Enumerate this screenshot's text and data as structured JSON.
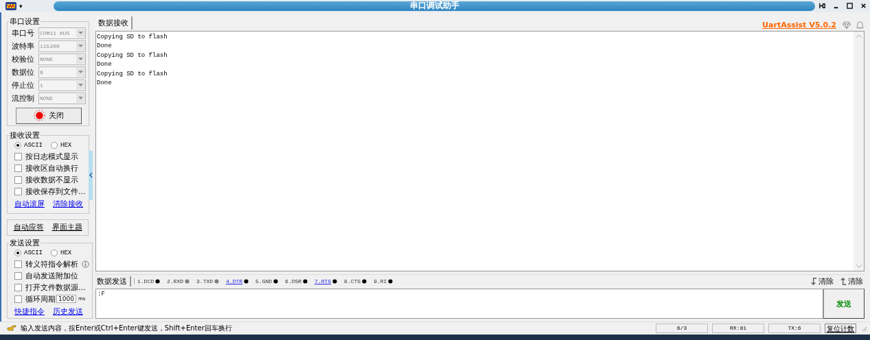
{
  "window": {
    "title": "串口调试助手",
    "menu_glyph": "▾"
  },
  "serial_settings": {
    "title": "串口设置",
    "fields": [
      {
        "label": "串口号",
        "value": "COM11 #US"
      },
      {
        "label": "波特率",
        "value": "115200"
      },
      {
        "label": "校验位",
        "value": "NONE"
      },
      {
        "label": "数据位",
        "value": "8"
      },
      {
        "label": "停止位",
        "value": "1"
      },
      {
        "label": "流控制",
        "value": "NONE"
      }
    ],
    "open_button": {
      "label": "关闭",
      "on": true
    }
  },
  "receive_settings": {
    "title": "接收设置",
    "modes": [
      {
        "label": "ASCII",
        "selected": true
      },
      {
        "label": "HEX",
        "selected": false
      }
    ],
    "options": [
      {
        "label": "按日志模式显示",
        "checked": false
      },
      {
        "label": "接收区自动换行",
        "checked": false
      },
      {
        "label": "接收数据不显示",
        "checked": false
      },
      {
        "label": "接收保存到文件...",
        "checked": false
      }
    ],
    "links": [
      "自动滚屏",
      "清除接收"
    ]
  },
  "toolbar": [
    "自动应答",
    "界面主题"
  ],
  "send_settings": {
    "title": "发送设置",
    "modes": [
      {
        "label": "ASCII",
        "selected": true
      },
      {
        "label": "HEX",
        "selected": false
      }
    ],
    "options": [
      {
        "label": "转义符指令解析",
        "checked": false,
        "kind": "info"
      },
      {
        "label": "自动发送附加位",
        "checked": false,
        "kind": "plain"
      },
      {
        "label": "打开文件数据源...",
        "checked": false,
        "kind": "plain"
      },
      {
        "label": "循环周期",
        "checked": false,
        "kind": "period",
        "value": "1000",
        "unit": "ms"
      }
    ],
    "links": [
      "快捷指令",
      "历史发送"
    ]
  },
  "receive": {
    "tab": "数据接收",
    "version": "UartAssist V5.0.2",
    "lines": [
      "Copying SD to flash",
      "Done",
      "Copying SD to flash",
      "Done",
      "Copying SD to flash",
      "Done"
    ]
  },
  "send": {
    "tab": "数据发送",
    "pins": [
      {
        "label": "1.DCD",
        "on": true,
        "kind": "plain"
      },
      {
        "label": "2.RXD",
        "on": false,
        "kind": "plain"
      },
      {
        "label": "3.TXD",
        "on": false,
        "kind": "plain"
      },
      {
        "label": "4.DTR",
        "on": true,
        "kind": "link"
      },
      {
        "label": "5.GND",
        "on": true,
        "kind": "plain"
      },
      {
        "label": "6.DSR",
        "on": true,
        "kind": "plain"
      },
      {
        "label": "7.RTS",
        "on": true,
        "kind": "link"
      },
      {
        "label": "8.CTS",
        "on": true,
        "kind": "plain"
      },
      {
        "label": "9.RI",
        "on": true,
        "kind": "plain"
      }
    ],
    "clear_buttons": [
      "清除",
      "清除"
    ],
    "input": ":F",
    "send_button": "发送"
  },
  "status_bar": {
    "hint": "输入发送内容，按Enter或Ctrl+Enter键发送，Shift+Enter回车换行",
    "counts": [
      "6/3",
      "RX:81",
      "TX:6"
    ],
    "reset_button": "复位计数"
  }
}
